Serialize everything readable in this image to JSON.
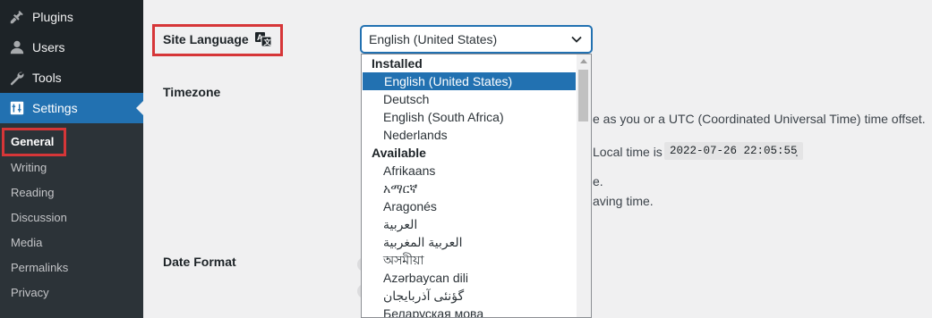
{
  "sidebar": {
    "items": [
      {
        "label": "Plugins",
        "icon": "plugin-icon"
      },
      {
        "label": "Users",
        "icon": "users-icon"
      },
      {
        "label": "Tools",
        "icon": "tools-icon"
      },
      {
        "label": "Settings",
        "icon": "settings-icon"
      }
    ],
    "submenu": [
      "General",
      "Writing",
      "Reading",
      "Discussion",
      "Media",
      "Permalinks",
      "Privacy"
    ]
  },
  "form": {
    "site_language_label": "Site Language",
    "timezone_label": "Timezone",
    "date_format_label": "Date Format",
    "selected_language": "English (United States)",
    "tz_description_fragment": "e as you or a UTC (Coordinated Universal Time) time offset.",
    "local_time_prefix": "Local time is",
    "local_time_value": "2022-07-26 22:05:55",
    "local_time_suffix": ".",
    "fragment_e": "e.",
    "fragment_saving": "aving time."
  },
  "dropdown": {
    "installed_label": "Installed",
    "installed": [
      "English (United States)",
      "Deutsch",
      "English (South Africa)",
      "Nederlands"
    ],
    "available_label": "Available",
    "available": [
      "Afrikaans",
      "አማርኛ",
      "Aragonés",
      "العربية",
      "العربية المغربية",
      "অসমীয়া",
      "Azərbaycan dili",
      "گؤنئی آذربایجان",
      "Беларуская мова"
    ],
    "selected_index": 0
  },
  "colors": {
    "sidebar_bg": "#1d2327",
    "submenu_bg": "#2c3338",
    "accent": "#2271b1",
    "highlight_box": "#d63638"
  }
}
